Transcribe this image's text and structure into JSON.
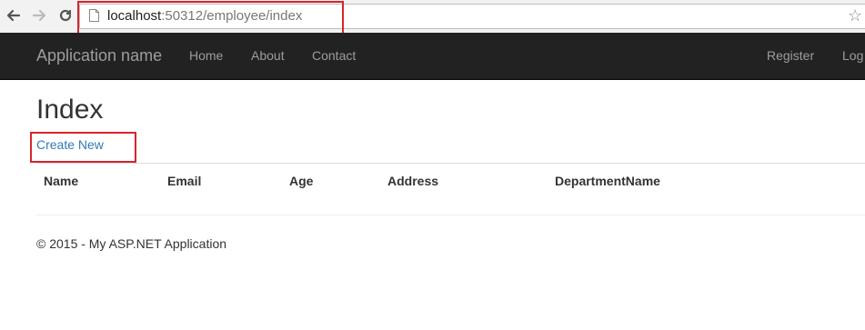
{
  "browser": {
    "url_host": "localhost",
    "url_path": ":50312/employee/index"
  },
  "navbar": {
    "brand": "Application name",
    "links": [
      "Home",
      "About",
      "Contact"
    ],
    "register": "Register",
    "login": "Log"
  },
  "main": {
    "title": "Index",
    "create_link": "Create New",
    "table": {
      "headers": [
        "Name",
        "Email",
        "Age",
        "Address",
        "DepartmentName"
      ]
    }
  },
  "footer": {
    "text": "© 2015 - My ASP.NET Application"
  },
  "colors": {
    "navbar": "#222222",
    "link": "#337ab7",
    "highlight": "#d9232d"
  }
}
